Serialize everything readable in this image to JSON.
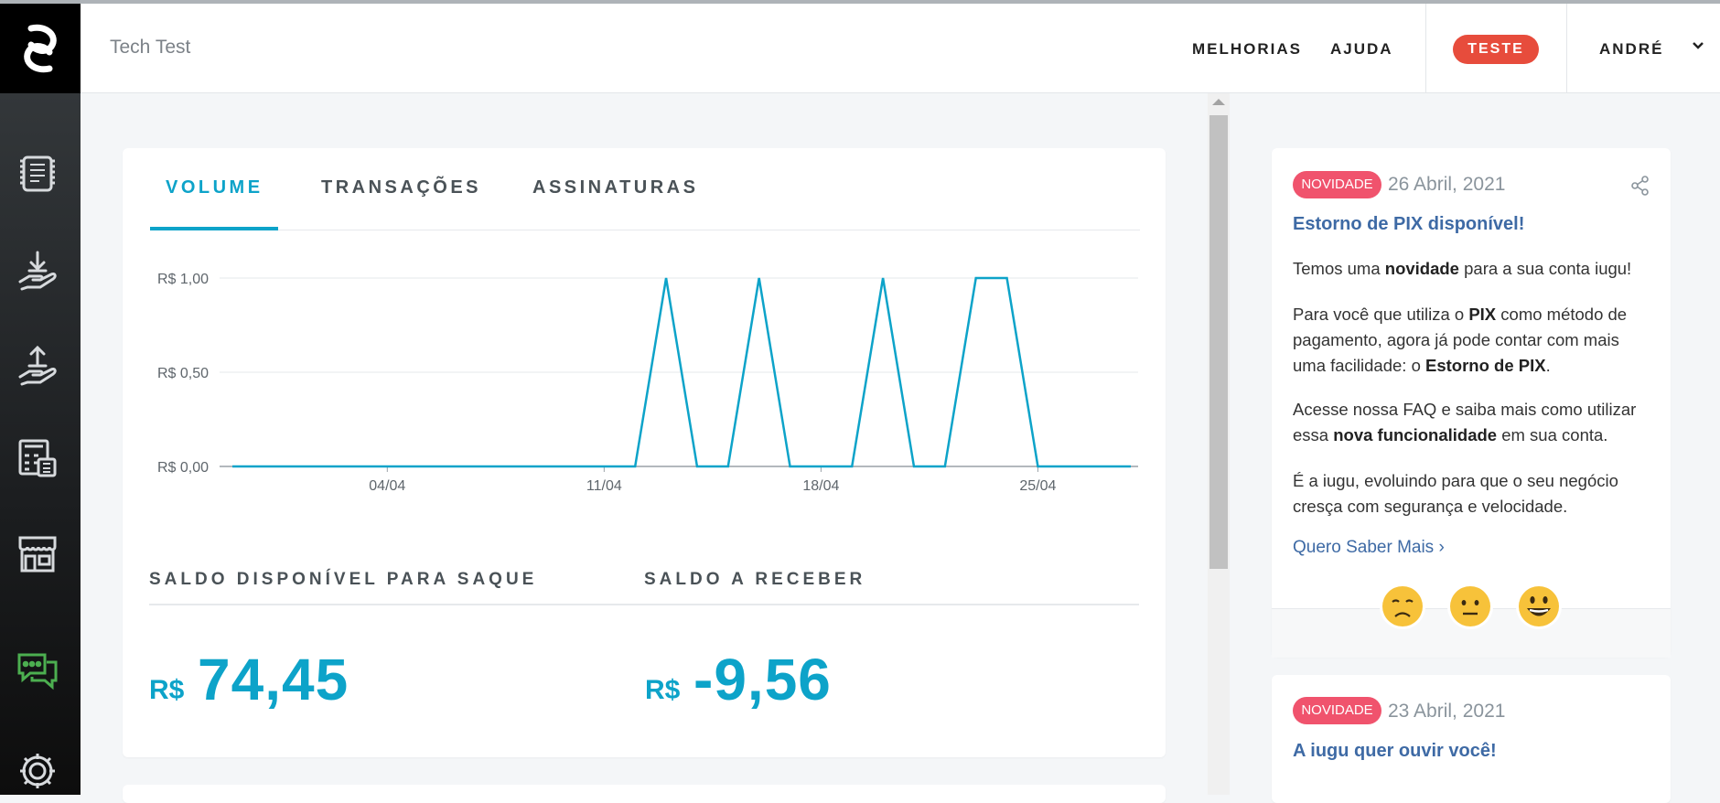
{
  "header": {
    "company": "Tech Test",
    "nav": [
      "MELHORIAS",
      "AJUDA"
    ],
    "env_badge": "TESTE",
    "user": "ANDRÉ"
  },
  "sidebar": {
    "items": [
      "invoice-icon",
      "receive-money-icon",
      "send-money-icon",
      "calculator-icon",
      "storefront-icon",
      "chat-icon",
      "settings-icon"
    ]
  },
  "dashboard": {
    "tabs": [
      "VOLUME",
      "TRANSAÇÕES",
      "ASSINATURAS"
    ],
    "active_tab": "VOLUME",
    "balances": [
      {
        "label": "SALDO DISPONÍVEL PARA SAQUE",
        "currency": "R$",
        "value": "74,45"
      },
      {
        "label": "SALDO A RECEBER",
        "currency": "R$",
        "value": "-9,56"
      }
    ]
  },
  "chart_data": {
    "type": "line",
    "series_color": "#0da3c9",
    "y_ticks": [
      "R$ 0,00",
      "R$ 0,50",
      "R$ 1,00"
    ],
    "ylim": [
      0,
      1
    ],
    "x_ticks": [
      {
        "label": "04/04",
        "index": 5
      },
      {
        "label": "11/04",
        "index": 12
      },
      {
        "label": "18/04",
        "index": 19
      },
      {
        "label": "25/04",
        "index": 26
      }
    ],
    "x": [
      "30/03",
      "31/03",
      "01/04",
      "02/04",
      "03/04",
      "04/04",
      "05/04",
      "06/04",
      "07/04",
      "08/04",
      "09/04",
      "10/04",
      "11/04",
      "12/04",
      "13/04",
      "14/04",
      "15/04",
      "16/04",
      "17/04",
      "18/04",
      "19/04",
      "20/04",
      "21/04",
      "22/04",
      "23/04",
      "24/04",
      "25/04",
      "26/04",
      "27/04",
      "28/04"
    ],
    "values": [
      0,
      0,
      0,
      0,
      0,
      0,
      0,
      0,
      0,
      0,
      0,
      0,
      0,
      0,
      1,
      0,
      0,
      1,
      0,
      0,
      0,
      1,
      0,
      0,
      1,
      1,
      0,
      0,
      0,
      0
    ],
    "grid": true
  },
  "news": [
    {
      "badge": "NOVIDADE",
      "date": "26 Abril, 2021",
      "title": "Estorno de PIX disponível!",
      "paragraphs": [
        [
          "Temos uma ",
          "novidade",
          " para a sua conta iugu!"
        ],
        [
          "Para você que utiliza o ",
          "PIX",
          " como método de pagamento, agora já pode contar com mais uma facilidade: o ",
          "Estorno de PIX",
          "."
        ],
        [
          "Acesse nossa FAQ e saiba mais como utilizar essa ",
          "nova funcionalidade",
          " em sua conta."
        ],
        [
          "É a iugu, evoluindo para que o seu negócio cresça com segurança e velocidade."
        ]
      ],
      "link": "Quero Saber Mais ›",
      "reactions": [
        "sad-emoji",
        "neutral-emoji",
        "happy-emoji"
      ]
    },
    {
      "badge": "NOVIDADE",
      "date": "23 Abril, 2021",
      "title": "A iugu quer ouvir você!"
    }
  ]
}
